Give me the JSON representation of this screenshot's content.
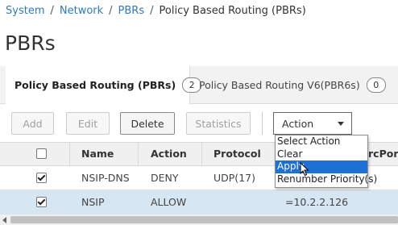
{
  "breadcrumb": {
    "items": [
      "System",
      "Network",
      "PBRs"
    ],
    "current": "Policy Based Routing (PBRs)",
    "separator": "/"
  },
  "page": {
    "title": "PBRs"
  },
  "tabs": [
    {
      "label": "Policy Based Routing (PBRs)",
      "count": "2",
      "active": true
    },
    {
      "label": "Policy Based Routing V6(PBR6s)",
      "count": "0",
      "active": false
    }
  ],
  "toolbar": {
    "add_label": "Add",
    "edit_label": "Edit",
    "delete_label": "Delete",
    "statistics_label": "Statistics",
    "action_label": "Action"
  },
  "table": {
    "columns": [
      "Name",
      "Action",
      "Protocol",
      "rcPort"
    ],
    "rows": [
      {
        "checked": true,
        "name": "NSIP-DNS",
        "action": "DENY",
        "protocol": "UDP(17)",
        "extra": ""
      },
      {
        "checked": true,
        "name": "NSIP",
        "action": "ALLOW",
        "protocol": "",
        "extra": "=10.2.2.126"
      }
    ]
  },
  "action_menu": {
    "items": [
      "Select Action",
      "Clear",
      "Apply",
      "Renumber Priority(s)"
    ],
    "highlighted": "Apply"
  },
  "colors": {
    "link": "#2b7bb9",
    "selected_row": "#d6e6f2",
    "menu_highlight": "#1e6fd6"
  },
  "icons": [
    "chevron-down-icon",
    "checkbox-icon",
    "mouse-cursor-icon",
    "scroll-left-arrow-icon"
  ]
}
